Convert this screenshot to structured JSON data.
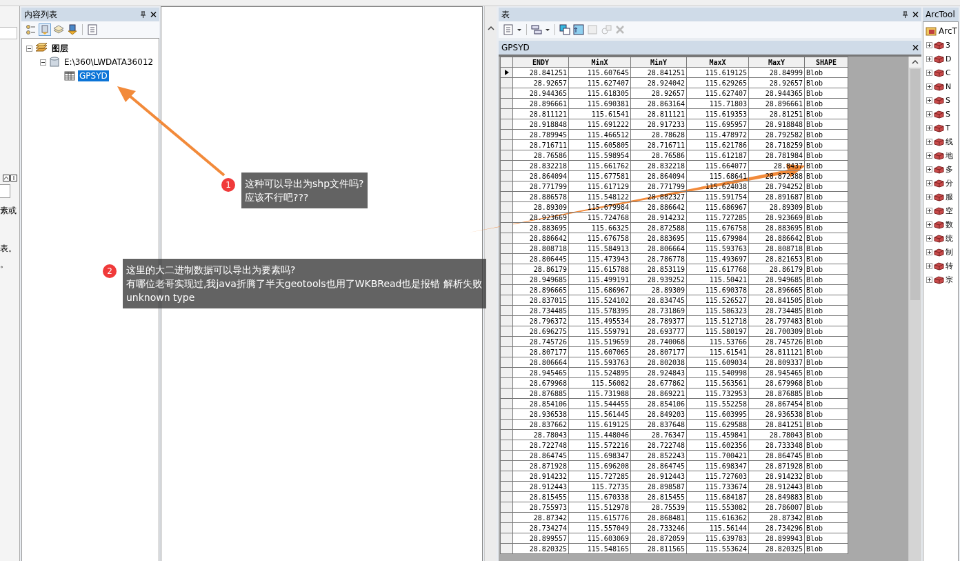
{
  "left_strip": {
    "texts": [
      "素或",
      "表。",
      "。"
    ]
  },
  "contents_panel": {
    "title": "内容列表",
    "tree": [
      {
        "label": "图层",
        "kind": "layers",
        "expanded": true,
        "children": [
          {
            "label": "E:\\360\\LWDATA36012",
            "kind": "database",
            "expanded": true,
            "children": [
              {
                "label": "GPSYD",
                "kind": "table",
                "selected": true
              }
            ]
          }
        ]
      }
    ]
  },
  "table_panel": {
    "title": "表",
    "tab": "GPSYD",
    "columns": [
      {
        "label": "ENDY",
        "kind": "number"
      },
      {
        "label": "MinX",
        "kind": "number"
      },
      {
        "label": "MinY",
        "kind": "number"
      },
      {
        "label": "MaxX",
        "kind": "number"
      },
      {
        "label": "MaxY",
        "kind": "number"
      },
      {
        "label": "SHAPE",
        "kind": "text"
      }
    ],
    "rows": [
      {
        "current": true,
        "cells": [
          "28.841251",
          "115.607645",
          "28.841251",
          "115.619125",
          "28.84999",
          "Blob"
        ]
      },
      {
        "current": false,
        "cells": [
          "28.92657",
          "115.627407",
          "28.924042",
          "115.629265",
          "28.92657",
          "Blob"
        ]
      },
      {
        "current": false,
        "cells": [
          "28.944365",
          "115.618305",
          "28.92657",
          "115.627407",
          "28.944365",
          "Blob"
        ]
      },
      {
        "current": false,
        "cells": [
          "28.896661",
          "115.690381",
          "28.863164",
          "115.71803",
          "28.896661",
          "Blob"
        ]
      },
      {
        "current": false,
        "cells": [
          "28.811121",
          "115.61541",
          "28.811121",
          "115.619353",
          "28.81251",
          "Blob"
        ]
      },
      {
        "current": false,
        "cells": [
          "28.918848",
          "115.691222",
          "28.917233",
          "115.695957",
          "28.918848",
          "Blob"
        ]
      },
      {
        "current": false,
        "cells": [
          "28.789945",
          "115.466512",
          "28.78628",
          "115.478972",
          "28.792582",
          "Blob"
        ]
      },
      {
        "current": false,
        "cells": [
          "28.716711",
          "115.605805",
          "28.716711",
          "115.621786",
          "28.718259",
          "Blob"
        ]
      },
      {
        "current": false,
        "cells": [
          "28.76586",
          "115.598954",
          "28.76586",
          "115.612187",
          "28.781984",
          "Blob"
        ]
      },
      {
        "current": false,
        "cells": [
          "28.832218",
          "115.661762",
          "28.832218",
          "115.664077",
          "28.8437",
          "Blob"
        ]
      },
      {
        "current": false,
        "cells": [
          "28.864094",
          "115.677581",
          "28.864094",
          "115.68641",
          "28.872388",
          "Blob"
        ]
      },
      {
        "current": false,
        "cells": [
          "28.771799",
          "115.617129",
          "28.771799",
          "115.624038",
          "28.794252",
          "Blob"
        ]
      },
      {
        "current": false,
        "cells": [
          "28.886578",
          "115.548122",
          "28.882327",
          "115.591754",
          "28.891687",
          "Blob"
        ]
      },
      {
        "current": false,
        "cells": [
          "28.89309",
          "115.679984",
          "28.886642",
          "115.686967",
          "28.89309",
          "Blob"
        ]
      },
      {
        "current": false,
        "cells": [
          "28.923669",
          "115.724768",
          "28.914232",
          "115.727285",
          "28.923669",
          "Blob"
        ]
      },
      {
        "current": false,
        "cells": [
          "28.883695",
          "115.66325",
          "28.872588",
          "115.676758",
          "28.883695",
          "Blob"
        ]
      },
      {
        "current": false,
        "cells": [
          "28.886642",
          "115.676758",
          "28.883695",
          "115.679984",
          "28.886642",
          "Blob"
        ]
      },
      {
        "current": false,
        "cells": [
          "28.808718",
          "115.584913",
          "28.806664",
          "115.593763",
          "28.808718",
          "Blob"
        ]
      },
      {
        "current": false,
        "cells": [
          "28.806445",
          "115.473943",
          "28.786778",
          "115.493697",
          "28.821653",
          "Blob"
        ]
      },
      {
        "current": false,
        "cells": [
          "28.86179",
          "115.615788",
          "28.853119",
          "115.617768",
          "28.86179",
          "Blob"
        ]
      },
      {
        "current": false,
        "cells": [
          "28.949685",
          "115.499191",
          "28.939252",
          "115.50421",
          "28.949685",
          "Blob"
        ]
      },
      {
        "current": false,
        "cells": [
          "28.896665",
          "115.686967",
          "28.89309",
          "115.690378",
          "28.896665",
          "Blob"
        ]
      },
      {
        "current": false,
        "cells": [
          "28.837015",
          "115.524102",
          "28.834745",
          "115.526527",
          "28.841505",
          "Blob"
        ]
      },
      {
        "current": false,
        "cells": [
          "28.734485",
          "115.578395",
          "28.731869",
          "115.586323",
          "28.734485",
          "Blob"
        ]
      },
      {
        "current": false,
        "cells": [
          "28.796372",
          "115.495534",
          "28.789377",
          "115.512718",
          "28.797483",
          "Blob"
        ]
      },
      {
        "current": false,
        "cells": [
          "28.696275",
          "115.559791",
          "28.693777",
          "115.580197",
          "28.700309",
          "Blob"
        ]
      },
      {
        "current": false,
        "cells": [
          "28.745726",
          "115.519659",
          "28.740068",
          "115.53766",
          "28.745726",
          "Blob"
        ]
      },
      {
        "current": false,
        "cells": [
          "28.807177",
          "115.607065",
          "28.807177",
          "115.61541",
          "28.811121",
          "Blob"
        ]
      },
      {
        "current": false,
        "cells": [
          "28.806664",
          "115.593763",
          "28.802038",
          "115.609034",
          "28.809337",
          "Blob"
        ]
      },
      {
        "current": false,
        "cells": [
          "28.945465",
          "115.524895",
          "28.924843",
          "115.540998",
          "28.945465",
          "Blob"
        ]
      },
      {
        "current": false,
        "cells": [
          "28.679968",
          "115.56082",
          "28.677862",
          "115.563561",
          "28.679968",
          "Blob"
        ]
      },
      {
        "current": false,
        "cells": [
          "28.876885",
          "115.731988",
          "28.869221",
          "115.732953",
          "28.876885",
          "Blob"
        ]
      },
      {
        "current": false,
        "cells": [
          "28.854106",
          "115.544455",
          "28.854106",
          "115.552258",
          "28.867454",
          "Blob"
        ]
      },
      {
        "current": false,
        "cells": [
          "28.936538",
          "115.561445",
          "28.849203",
          "115.603995",
          "28.936538",
          "Blob"
        ]
      },
      {
        "current": false,
        "cells": [
          "28.837662",
          "115.619125",
          "28.837648",
          "115.629588",
          "28.841251",
          "Blob"
        ]
      },
      {
        "current": false,
        "cells": [
          "28.78043",
          "115.448046",
          "28.76347",
          "115.459841",
          "28.78043",
          "Blob"
        ]
      },
      {
        "current": false,
        "cells": [
          "28.722748",
          "115.572216",
          "28.722748",
          "115.602356",
          "28.733348",
          "Blob"
        ]
      },
      {
        "current": false,
        "cells": [
          "28.864745",
          "115.698347",
          "28.852243",
          "115.700421",
          "28.864745",
          "Blob"
        ]
      },
      {
        "current": false,
        "cells": [
          "28.871928",
          "115.696208",
          "28.864745",
          "115.698347",
          "28.871928",
          "Blob"
        ]
      },
      {
        "current": false,
        "cells": [
          "28.914232",
          "115.727285",
          "28.912443",
          "115.727603",
          "28.914232",
          "Blob"
        ]
      },
      {
        "current": false,
        "cells": [
          "28.912443",
          "115.72735",
          "28.898587",
          "115.733674",
          "28.912443",
          "Blob"
        ]
      },
      {
        "current": false,
        "cells": [
          "28.815455",
          "115.670338",
          "28.815455",
          "115.684187",
          "28.849883",
          "Blob"
        ]
      },
      {
        "current": false,
        "cells": [
          "28.755973",
          "115.512978",
          "28.75539",
          "115.553082",
          "28.786007",
          "Blob"
        ]
      },
      {
        "current": false,
        "cells": [
          "28.87342",
          "115.615776",
          "28.868481",
          "115.616362",
          "28.87342",
          "Blob"
        ]
      },
      {
        "current": false,
        "cells": [
          "28.734274",
          "115.557049",
          "28.733246",
          "115.56144",
          "28.734296",
          "Blob"
        ]
      },
      {
        "current": false,
        "cells": [
          "28.899557",
          "115.603069",
          "28.872059",
          "115.639783",
          "28.899943",
          "Blob"
        ]
      },
      {
        "current": false,
        "cells": [
          "28.820325",
          "115.548165",
          "28.811565",
          "115.553624",
          "28.820325",
          "Blob"
        ]
      }
    ]
  },
  "toolbox": {
    "title": "ArcTool",
    "root": "ArcT",
    "items": [
      {
        "label": "3",
        "expanded": false
      },
      {
        "label": "D",
        "expanded": false
      },
      {
        "label": "C",
        "expanded": false
      },
      {
        "label": "N",
        "expanded": false
      },
      {
        "label": "S",
        "expanded": false
      },
      {
        "label": "S",
        "expanded": false
      },
      {
        "label": "T",
        "expanded": false
      },
      {
        "label": "线",
        "expanded": false
      },
      {
        "label": "地",
        "expanded": false
      },
      {
        "label": "多",
        "expanded": false
      },
      {
        "label": "分",
        "expanded": false
      },
      {
        "label": "服",
        "expanded": false
      },
      {
        "label": "空",
        "expanded": false
      },
      {
        "label": "数",
        "expanded": false
      },
      {
        "label": "统",
        "expanded": false
      },
      {
        "label": "制",
        "expanded": false
      },
      {
        "label": "转",
        "expanded": false
      },
      {
        "label": "宗",
        "expanded": false
      }
    ]
  },
  "annotations": [
    {
      "number": "1",
      "lines": [
        "这种可以导出为shp文件吗?",
        "应该不行吧???"
      ]
    },
    {
      "number": "2",
      "lines": [
        "这里的大二进制数据可以导出为要素吗?",
        "有哪位老哥实现过,我java折腾了半天geotools也用了WKBRead也是报错 解析失败",
        "unknown type"
      ]
    }
  ]
}
